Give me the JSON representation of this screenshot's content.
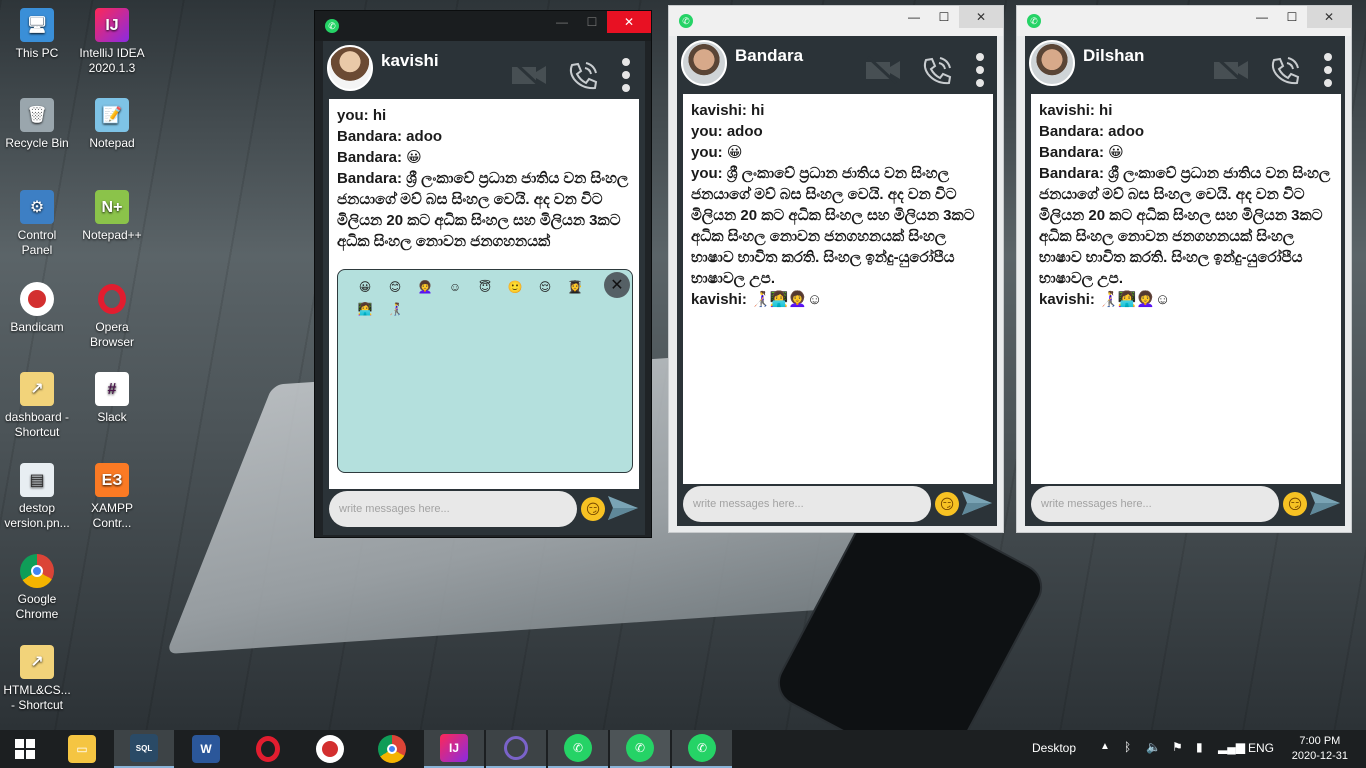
{
  "desktop_icons": [
    {
      "label": "This PC",
      "icon": "this-pc-icon"
    },
    {
      "label": "IntelliJ IDEA 2020.1.3",
      "icon": "intellij-icon"
    },
    {
      "label": "Recycle Bin",
      "icon": "recycle-bin-icon"
    },
    {
      "label": "Notepad",
      "icon": "notepad-icon"
    },
    {
      "label": "Control Panel",
      "icon": "control-panel-icon"
    },
    {
      "label": "Notepad++",
      "icon": "notepadpp-icon"
    },
    {
      "label": "Bandicam",
      "icon": "bandicam-icon"
    },
    {
      "label": "Opera Browser",
      "icon": "opera-icon"
    },
    {
      "label": "dashboard - Shortcut",
      "icon": "shortcut-icon"
    },
    {
      "label": "Slack",
      "icon": "slack-icon"
    },
    {
      "label": "destop version.pn...",
      "icon": "image-file-icon"
    },
    {
      "label": "XAMPP Contr...",
      "icon": "xampp-icon"
    },
    {
      "label": "Google Chrome",
      "icon": "chrome-icon"
    },
    {
      "label": "HTML&CS... - Shortcut",
      "icon": "shortcut-icon"
    }
  ],
  "chats": [
    {
      "contact": "kavishi",
      "messages": [
        "you: hi",
        "Bandara: adoo",
        "Bandara: 😀",
        "Bandara: ශ්‍රී ලංකාවේ ප්‍රධාන ජාතිය වන සිංහල ජනයාගේ මව් බස සිංහල වෙයි. අද වන විට මිලියන 20 කට අධික සිංහල සහ මිලියන 3කට අධික සිංහල නොවන ජනගහනයක්"
      ],
      "emoji_panel": [
        "😀",
        "😊",
        "👩‍🦱",
        "☺",
        "😇",
        "🙂",
        "😌",
        "👩‍🎓",
        "👩‍💻",
        "👩‍🦯"
      ],
      "input_placeholder": "write messages here..."
    },
    {
      "contact": "Bandara",
      "messages": [
        "kavishi: hi",
        "you: adoo",
        "you: 😀",
        "you: ශ්‍රී ලංකාවේ ප්‍රධාන ජාතිය වන සිංහල ජනයාගේ මව් බස සිංහල වෙයි. අද වන විට මිලියන 20 කට අධික සිංහල සහ මිලියන 3කට අධික සිංහල නොවන ජනගහනයක් සිංහල භාෂාව භාවිත කරති. සිංහල ඉන්දු-යුරෝපීය භාෂාවල උප.",
        "kavishi:  👩‍🦯👩‍💻👩‍🦱☺"
      ],
      "input_placeholder": "write messages here..."
    },
    {
      "contact": "Dilshan",
      "messages": [
        "kavishi: hi",
        "Bandara: adoo",
        "Bandara: 😀",
        "Bandara: ශ්‍රී ලංකාවේ ප්‍රධාන ජාතිය වන සිංහල ජනයාගේ මව් බස සිංහල වෙයි. අද වන විට මිලියන 20 කට අධික සිංහල සහ මිලියන 3කට අධික සිංහල නොවන ජනගහනයක් සිංහල භාෂාව භාවිත කරති. සිංහල ඉන්දු-යුරෝපීය භාෂාවල උප.",
        "kavishi:  👩‍🦯👩‍💻👩‍🦱☺"
      ],
      "input_placeholder": "write messages here..."
    }
  ],
  "taskbar": {
    "tray_desktop": "Desktop",
    "tray_lang": "ENG",
    "clock_time": "7:00 PM",
    "clock_date": "2020-12-31"
  },
  "colors": {
    "whatsapp": "#25d366",
    "chat_panel": "#2b3338",
    "emoji_panel": "#b4e0dd"
  }
}
